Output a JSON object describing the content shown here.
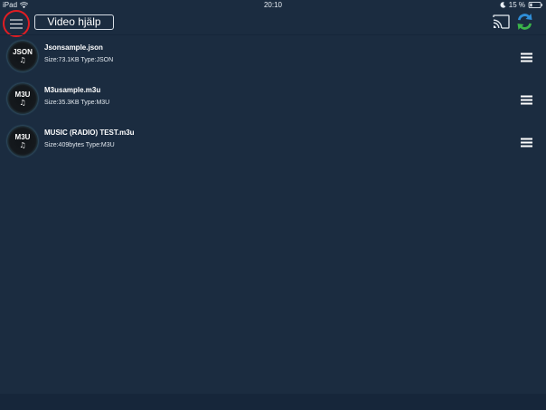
{
  "status_bar": {
    "device": "iPad",
    "time": "20:10",
    "battery": "15 %",
    "icons": [
      "wifi-icon",
      "moon-icon",
      "battery-icon"
    ]
  },
  "header": {
    "title": "Video hjälp",
    "icons": [
      "hamburger-menu-icon",
      "cast-icon",
      "sync-icon"
    ]
  },
  "files": [
    {
      "type_badge": "JSON",
      "note": "♫",
      "name": "Jsonsample.json",
      "meta": "Size:73.1KB Type:JSON"
    },
    {
      "type_badge": "M3U",
      "note": "♫",
      "name": "M3usample.m3u",
      "meta": "Size:35.3KB Type:M3U"
    },
    {
      "type_badge": "M3U",
      "note": "♫",
      "name": "MUSIC (RADIO) TEST.m3u",
      "meta": "Size:409bytes Type:M3U"
    }
  ],
  "colors": {
    "background": "#1b2c40",
    "menu_ring": "#e11d23",
    "sync_blue": "#2f8ed8",
    "sync_green": "#3bb44a"
  }
}
